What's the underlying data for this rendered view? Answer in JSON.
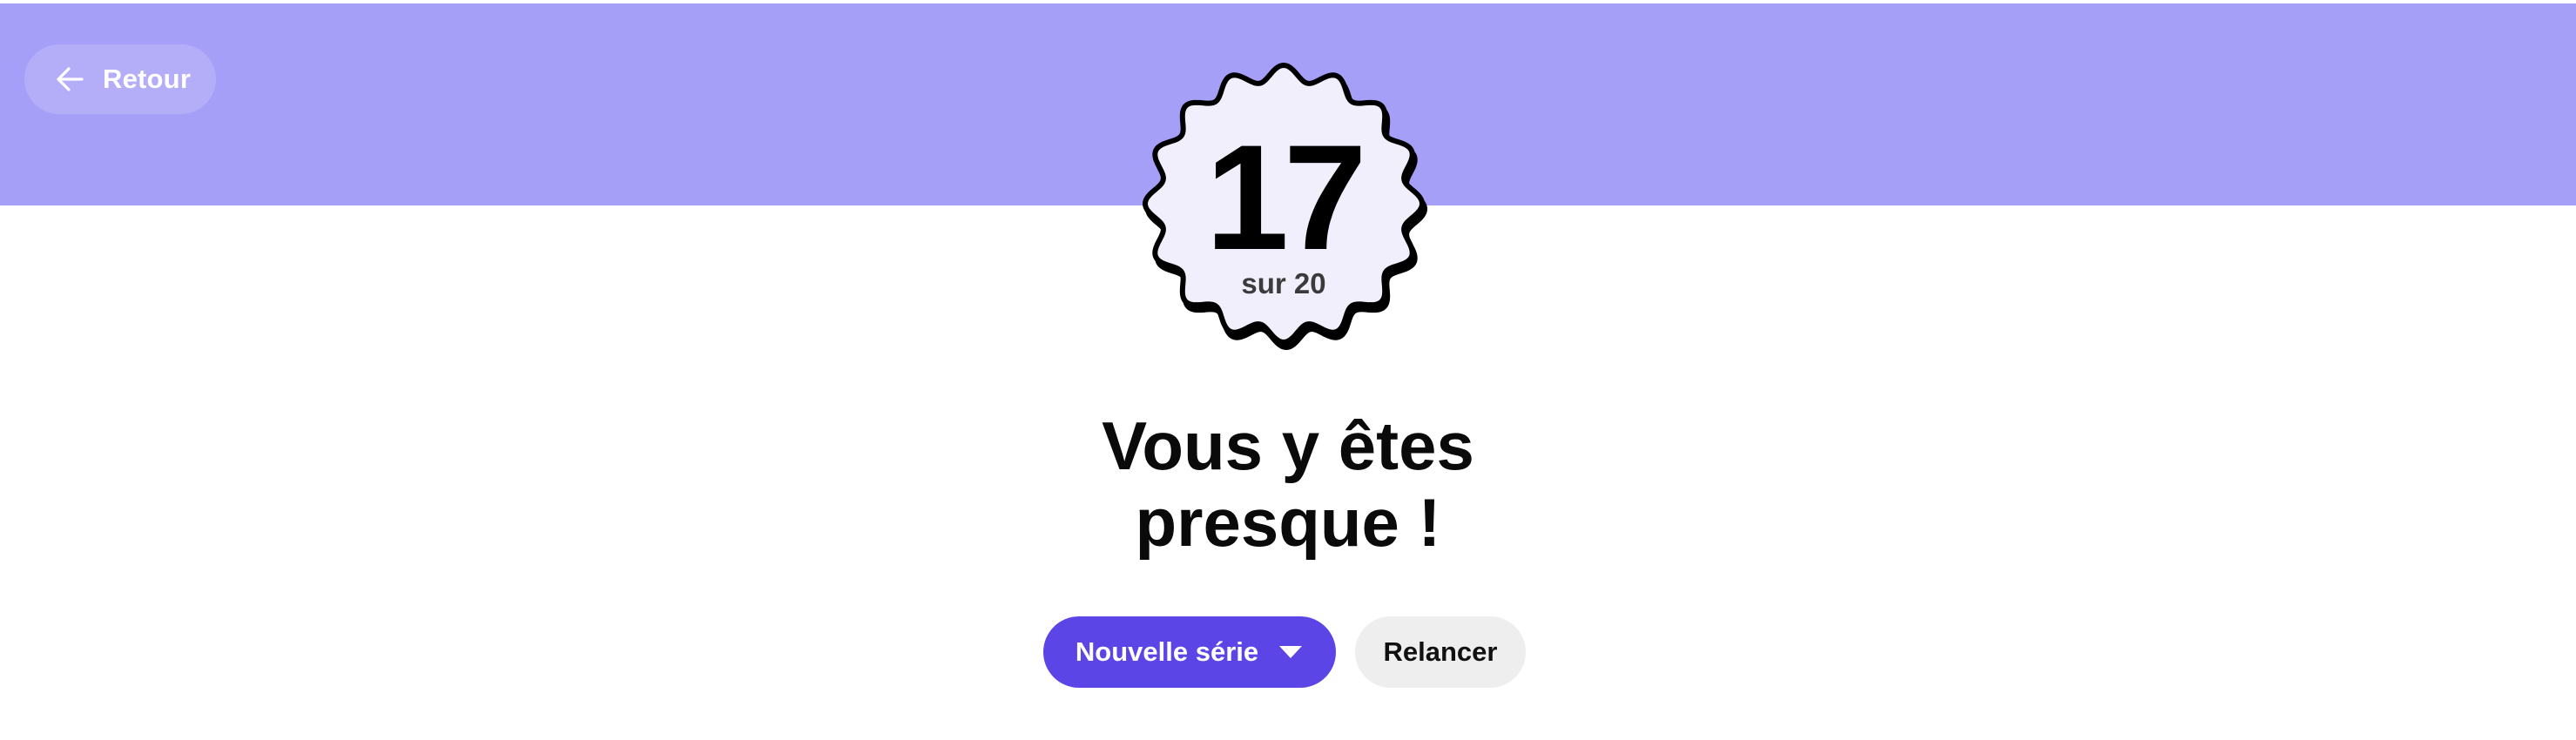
{
  "header": {
    "back_label": "Retour",
    "back_icon": "arrow-left-icon",
    "band_color": "#a69ff7"
  },
  "result": {
    "score": "17",
    "total_label": "sur 20",
    "badge_fill": "#f1effc"
  },
  "message": {
    "line1": "Vous y êtes",
    "line2": "presque !"
  },
  "actions": {
    "new_series_label": "Nouvelle série",
    "new_series_icon": "caret-down-icon",
    "retry_label": "Relancer",
    "primary_color": "#5b45e6",
    "secondary_color": "#eeeeee"
  }
}
